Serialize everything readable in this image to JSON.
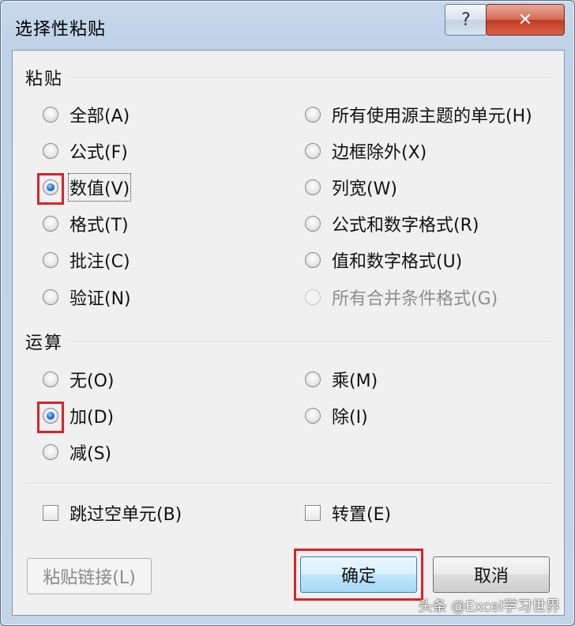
{
  "dialog": {
    "title": "选择性粘贴"
  },
  "titlebar": {
    "help_label": "?",
    "close_label": "✕"
  },
  "paste": {
    "heading": "粘贴",
    "options": [
      {
        "label": "全部(A)",
        "checked": false
      },
      {
        "label": "公式(F)",
        "checked": false
      },
      {
        "label": "数值(V)",
        "checked": true
      },
      {
        "label": "格式(T)",
        "checked": false
      },
      {
        "label": "批注(C)",
        "checked": false
      },
      {
        "label": "验证(N)",
        "checked": false
      },
      {
        "label": "所有使用源主题的单元(H)",
        "checked": false
      },
      {
        "label": "边框除外(X)",
        "checked": false
      },
      {
        "label": "列宽(W)",
        "checked": false
      },
      {
        "label": "公式和数字格式(R)",
        "checked": false
      },
      {
        "label": "值和数字格式(U)",
        "checked": false
      },
      {
        "label": "所有合并条件格式(G)",
        "checked": false,
        "disabled": true
      }
    ]
  },
  "operation": {
    "heading": "运算",
    "options": [
      {
        "label": "无(O)",
        "checked": false
      },
      {
        "label": "加(D)",
        "checked": true
      },
      {
        "label": "减(S)",
        "checked": false
      },
      {
        "label": "乘(M)",
        "checked": false
      },
      {
        "label": "除(I)",
        "checked": false
      }
    ]
  },
  "checks": {
    "skip_blanks": {
      "label": "跳过空单元(B)",
      "checked": false
    },
    "transpose": {
      "label": "转置(E)",
      "checked": false
    }
  },
  "buttons": {
    "paste_link": "粘贴链接(L)",
    "ok": "确定",
    "cancel": "取消"
  },
  "watermark": "头条 @Excel学习世界",
  "colors": {
    "highlight": "#d8232a",
    "accent": "#2a7fd4"
  }
}
